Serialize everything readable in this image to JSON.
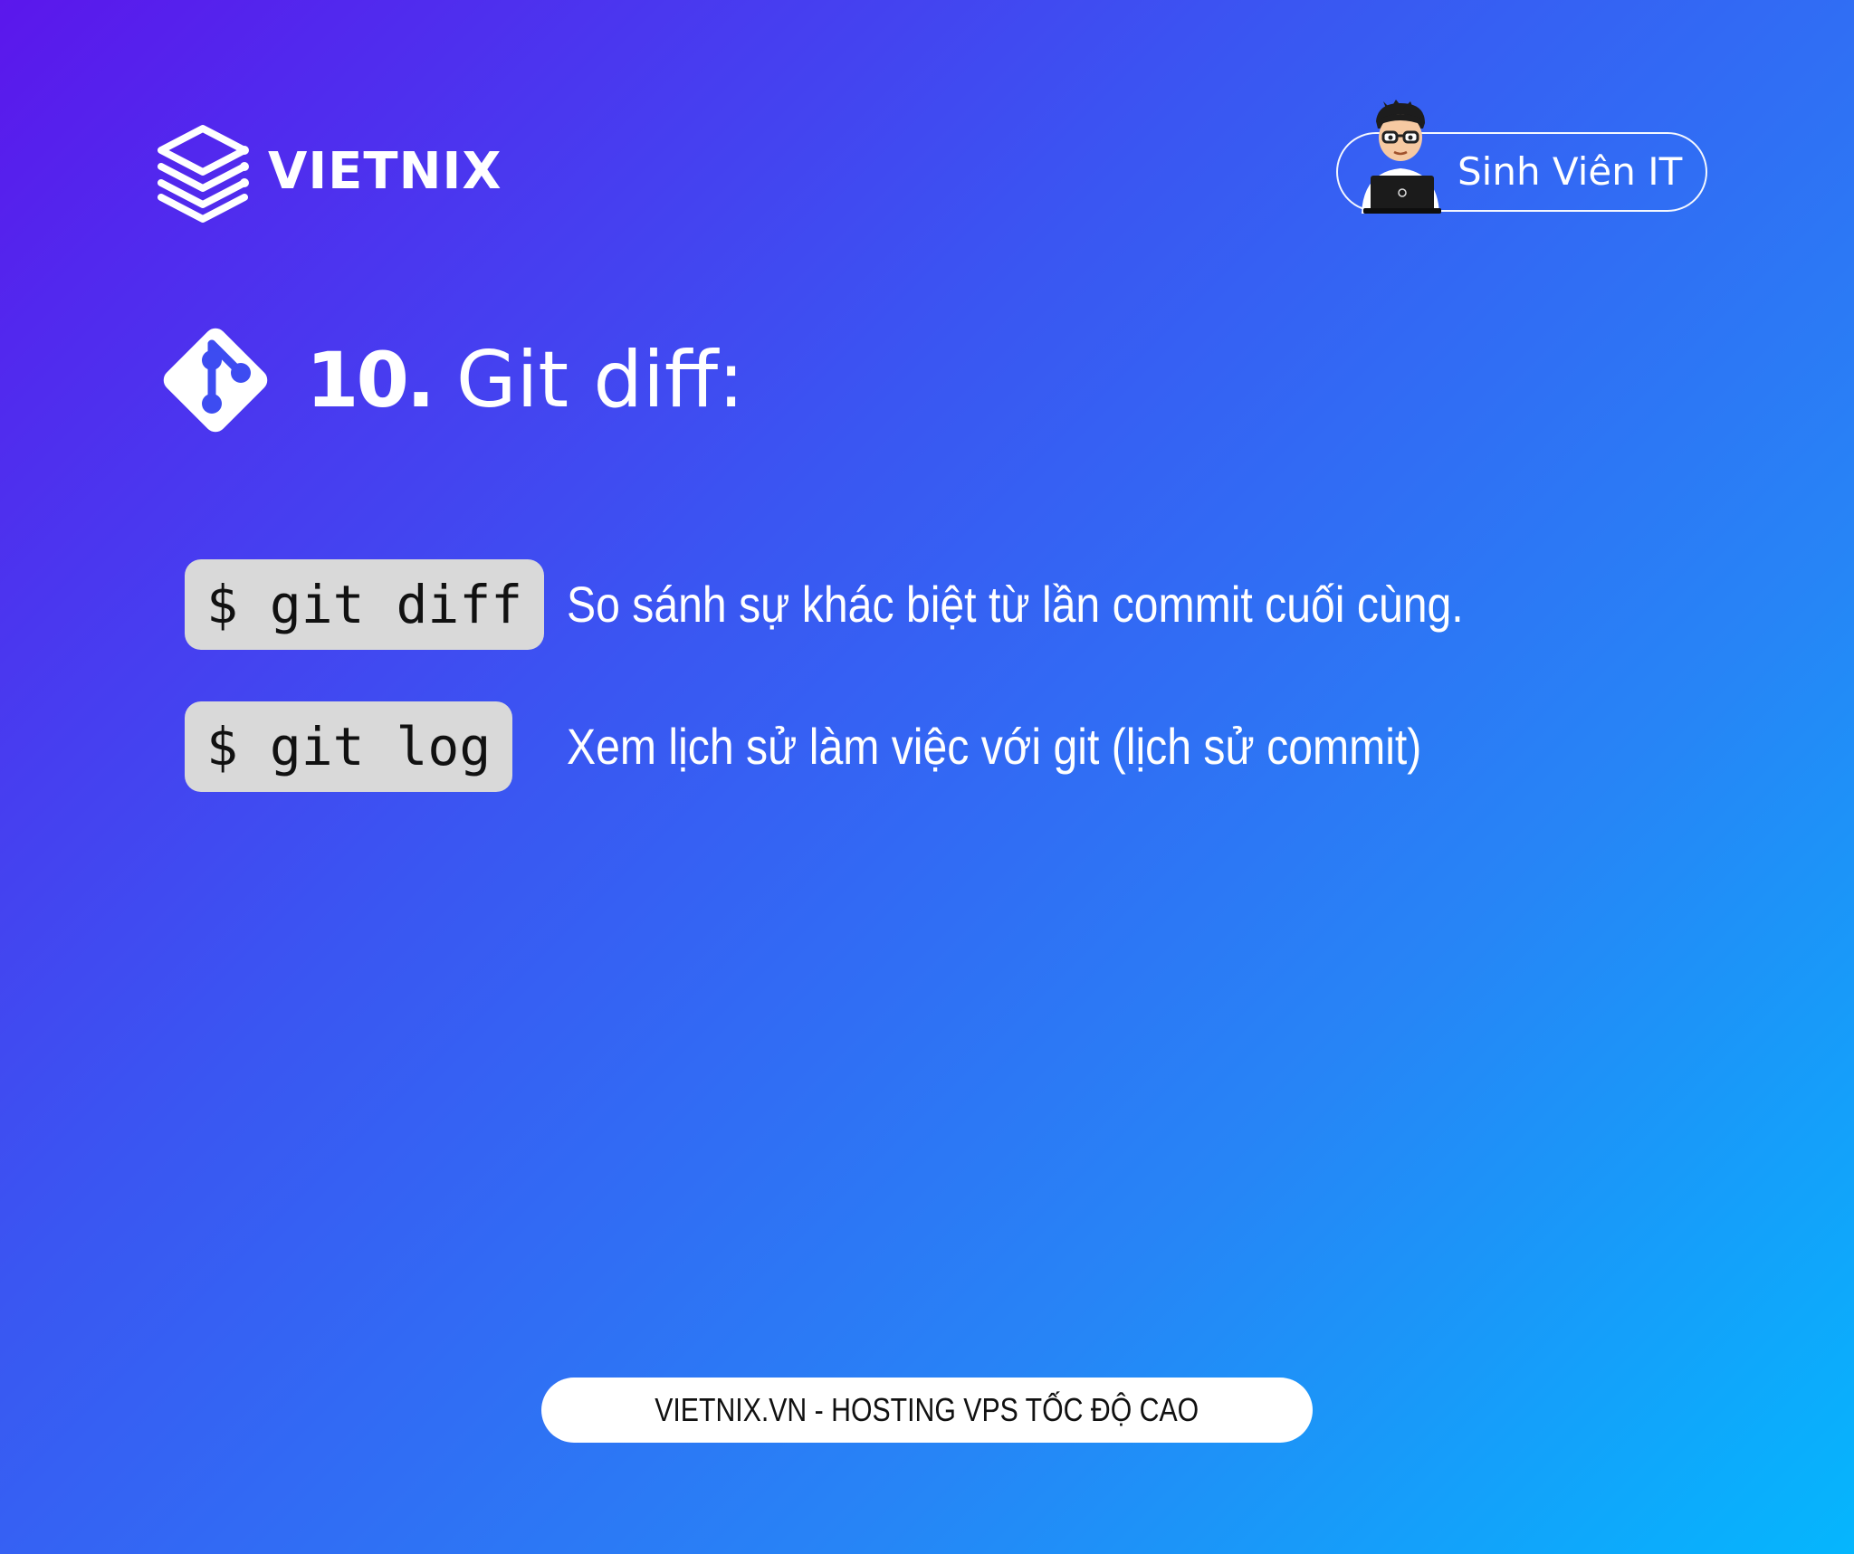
{
  "brand": {
    "name": "VIETNIX",
    "logo_icon": "stacked-layers-icon"
  },
  "badge": {
    "label": "Sinh Viên IT",
    "icon": "student-avatar-icon"
  },
  "heading": {
    "number": "10.",
    "title": "Git diff:",
    "icon": "git-icon"
  },
  "commands": [
    {
      "command": "$ git diff",
      "description": "So sánh sự khác biệt từ lần commit cuối cùng."
    },
    {
      "command": "$ git log",
      "description": "Xem lịch sử làm việc với git (lịch sử commit)"
    }
  ],
  "footer": {
    "text": "VIETNIX.VN - HOSTING VPS TỐC ĐỘ CAO"
  },
  "colors": {
    "gradient_start": "#5b17ec",
    "gradient_end": "#05b6fd",
    "code_background": "#d9d9d9",
    "text": "#ffffff"
  }
}
